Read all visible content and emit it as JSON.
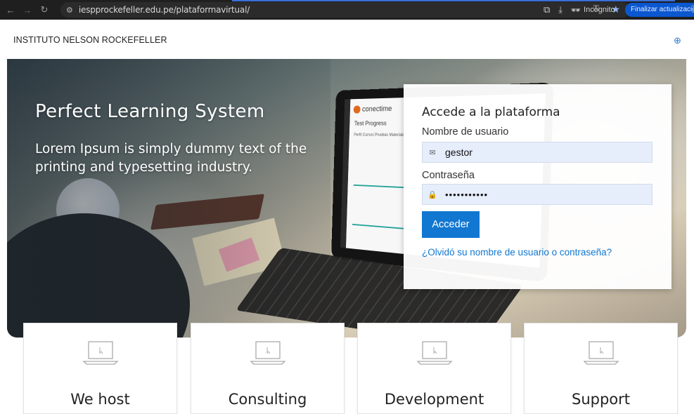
{
  "browser": {
    "url": "iespprockefeller.edu.pe/plataformavirtual/",
    "incognito_label": "Incógnito",
    "update_label": "Finalizar actualización"
  },
  "site": {
    "title": "INSTITUTO NELSON ROCKEFELLER"
  },
  "hero": {
    "title": "Perfect Learning System",
    "subtitle": "Lorem Ipsum is simply dummy text of the printing and typesetting industry.",
    "screen": {
      "brand": "conectime",
      "heading": "Test Progress",
      "tabs": "Perfil   Cursos   Pruebas   Materiales"
    }
  },
  "login": {
    "heading": "Accede a la plataforma",
    "username_label": "Nombre de usuario",
    "username_value": "gestor",
    "password_label": "Contraseña",
    "password_value": "•••••••••••",
    "submit_label": "Acceder",
    "forgot_link": "¿Olvidó su nombre de usuario o contraseña?"
  },
  "features": [
    {
      "title": "We host"
    },
    {
      "title": "Consulting"
    },
    {
      "title": "Development"
    },
    {
      "title": "Support"
    }
  ],
  "colors": {
    "primary": "#1177d1",
    "chrome_bg": "#1f1f1f",
    "input_bg": "#e6edfb"
  }
}
